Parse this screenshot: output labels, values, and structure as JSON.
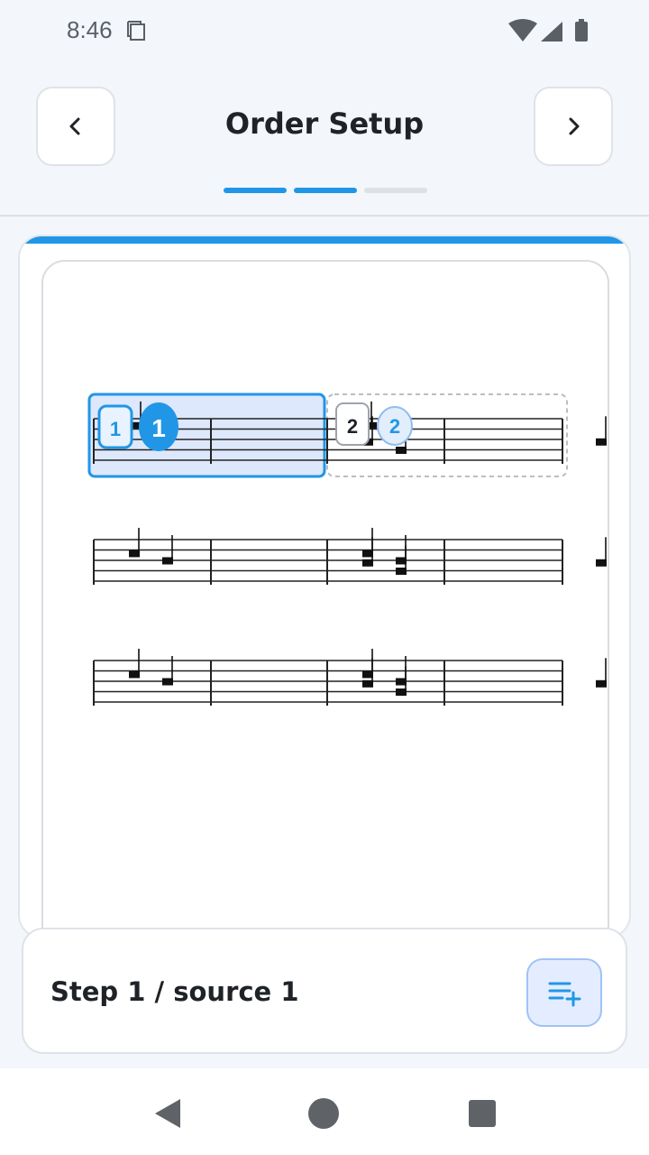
{
  "status_bar": {
    "time": "8:46",
    "icons": [
      "sim-card-icon",
      "wifi-icon",
      "signal-icon",
      "battery-icon"
    ]
  },
  "header": {
    "title": "Order Setup",
    "prev_icon": "chevron-left-icon",
    "next_icon": "chevron-right-icon",
    "progress": {
      "total_steps": 3,
      "completed_steps": 2
    }
  },
  "score": {
    "sources": [
      {
        "index_label": "1",
        "marker_label": "1",
        "state": "selected"
      },
      {
        "index_label": "2",
        "marker_label": "2",
        "state": "pending"
      }
    ]
  },
  "bottom": {
    "step_label": "Step 1 / source 1",
    "add_icon": "playlist-add-icon"
  },
  "colors": {
    "accent": "#2196e6",
    "selection_fill": "#dde8fc",
    "progress_inactive": "#dde1e6",
    "add_button_bg": "#e4edff"
  }
}
